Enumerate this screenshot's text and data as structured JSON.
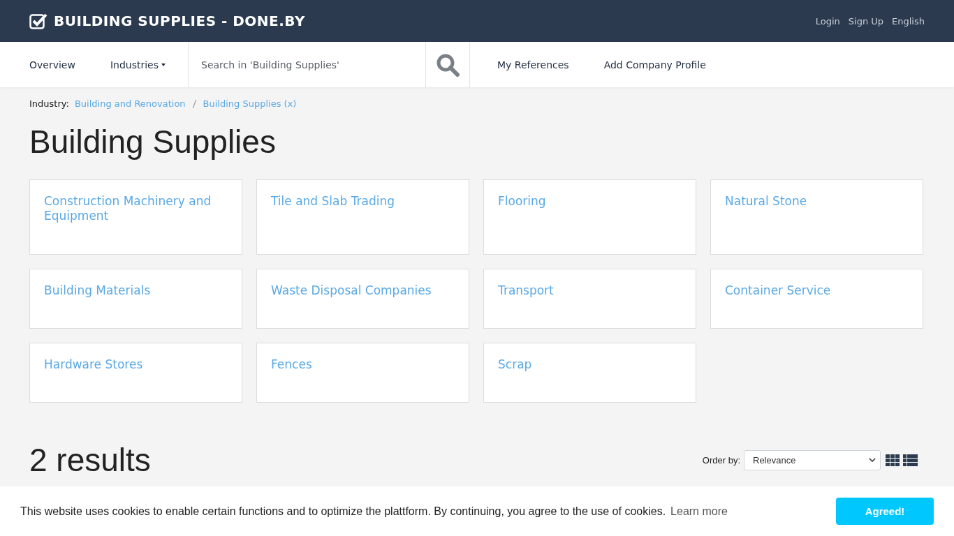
{
  "header": {
    "logo": "BUILDING SUPPLIES - DONE.BY",
    "links": [
      "Login",
      "Sign Up",
      "English"
    ]
  },
  "nav": {
    "items": [
      {
        "label": "Overview",
        "dropdown": false
      },
      {
        "label": "Industries",
        "dropdown": true
      }
    ],
    "search": {
      "placeholder": "Search in 'Building Supplies'"
    },
    "links": [
      "My References",
      "Add Company Profile"
    ]
  },
  "breadcrumb": {
    "label": "Industry:",
    "items": [
      "Building and Renovation",
      "Building Supplies (x)"
    ]
  },
  "title": "Building Supplies",
  "categories": [
    {
      "label": "Construction Machinery and Equipment"
    },
    {
      "label": "Tile and Slab Trading"
    },
    {
      "label": "Flooring"
    },
    {
      "label": "Natural Stone"
    },
    {
      "label": "Building Materials"
    },
    {
      "label": "Waste Disposal Companies"
    },
    {
      "label": "Transport"
    },
    {
      "label": "Container Service"
    },
    {
      "label": "Hardware Stores"
    },
    {
      "label": "Fences"
    },
    {
      "label": "Scrap"
    }
  ],
  "results": {
    "count": "2 results",
    "order_label": "Order by:",
    "order_value": "Relevance"
  },
  "cookie": {
    "text": "This website uses cookies to enable certain functions and to optimize the plattform. By continuing, you agree to the use of cookies.",
    "link": "Learn more",
    "button": "Agreed!"
  }
}
